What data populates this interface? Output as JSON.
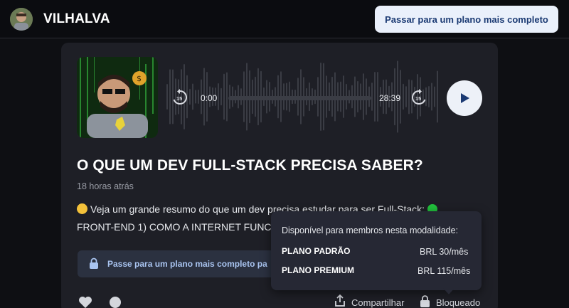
{
  "header": {
    "channel_name": "VILHALVA",
    "upgrade_button": "Passar para um plano mais completo"
  },
  "player": {
    "current_time": "0:00",
    "duration": "28:39",
    "skip_back_seconds": "15",
    "skip_forward_seconds": "15",
    "progress": 0
  },
  "post": {
    "title": "O QUE UM DEV FULL-STACK PRECISA SABER?",
    "posted": "18 horas atrás",
    "description_line1": "Veja um grande resumo do que um dev precisa estudar para ser Full-Stack:",
    "description_line2": "FRONT-END 1) COMO A INTERNET FUNC",
    "locked_message": "Passe para um plano mais completo pa"
  },
  "actions": {
    "share": "Compartilhar",
    "blocked": "Bloqueado"
  },
  "tooltip": {
    "heading": "Disponível para membros nesta modalidade:",
    "plans": [
      {
        "name": "PLANO PADRÃO",
        "price": "BRL 30/mês"
      },
      {
        "name": "PLANO PREMIUM",
        "price": "BRL 115/mês"
      }
    ]
  },
  "icons": {
    "play": "play-icon",
    "skip_back": "skip-back-15-icon",
    "skip_forward": "skip-forward-15-icon",
    "lock": "lock-icon",
    "heart": "heart-icon",
    "comment": "comment-icon",
    "share": "share-icon"
  },
  "colors": {
    "accent_button_bg": "#eaf0fb",
    "accent_button_text": "#1b3a73",
    "card_bg": "#1e1f26",
    "locked_text": "#a9c4f0"
  }
}
